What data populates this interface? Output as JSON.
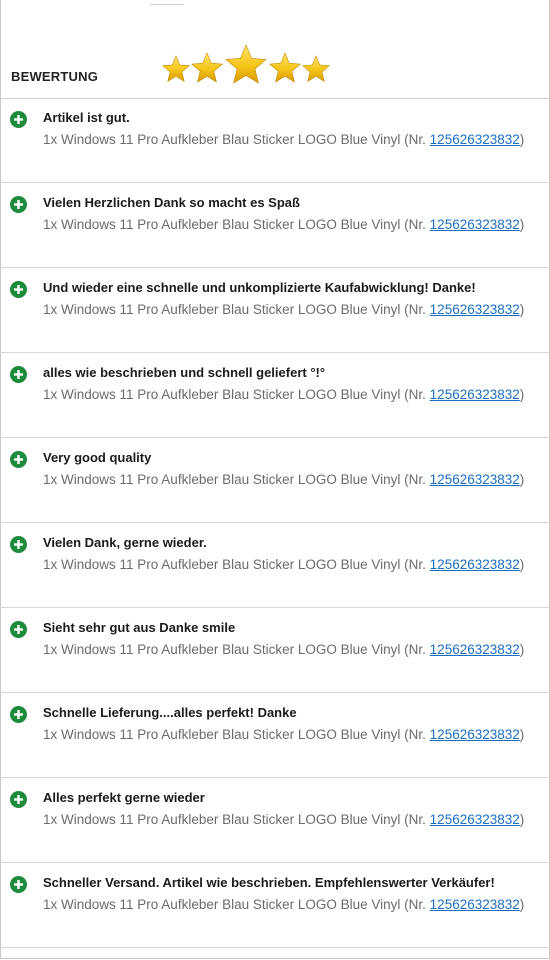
{
  "header": {
    "title": "BEWERTUNG",
    "rating": 5,
    "rating_max": 5,
    "star_color": "#f5c518"
  },
  "colors": {
    "positive_icon": "#1e8a3c",
    "link": "#1a6fc2"
  },
  "feedback": [
    {
      "comment": "Artikel ist gut.",
      "item_prefix": "1x Windows 11 Pro Aufkleber Blau Sticker LOGO Blue Vinyl (Nr. ",
      "item_number": "125626323832",
      "item_suffix": ")",
      "icon": "plus-circle-icon"
    },
    {
      "comment": "Vielen Herzlichen Dank so macht es Spaß",
      "item_prefix": "1x Windows 11 Pro Aufkleber Blau Sticker LOGO Blue Vinyl (Nr. ",
      "item_number": "125626323832",
      "item_suffix": ")",
      "icon": "plus-circle-icon"
    },
    {
      "comment": "Und wieder eine schnelle und unkomplizierte Kaufabwicklung! Danke!",
      "item_prefix": "1x Windows 11 Pro Aufkleber Blau Sticker LOGO Blue Vinyl (Nr. ",
      "item_number": "125626323832",
      "item_suffix": ")",
      "icon": "plus-circle-icon"
    },
    {
      "comment": "alles wie beschrieben und schnell geliefert °!°",
      "item_prefix": "1x Windows 11 Pro Aufkleber Blau Sticker LOGO Blue Vinyl (Nr. ",
      "item_number": "125626323832",
      "item_suffix": ")",
      "icon": "plus-circle-icon"
    },
    {
      "comment": "Very good quality",
      "item_prefix": "1x Windows 11 Pro Aufkleber Blau Sticker LOGO Blue Vinyl (Nr. ",
      "item_number": "125626323832",
      "item_suffix": ")",
      "icon": "plus-circle-icon"
    },
    {
      "comment": "Vielen Dank, gerne wieder.",
      "item_prefix": "1x Windows 11 Pro Aufkleber Blau Sticker LOGO Blue Vinyl (Nr. ",
      "item_number": "125626323832",
      "item_suffix": ")",
      "icon": "plus-circle-icon"
    },
    {
      "comment": "Sieht sehr gut aus Danke smile",
      "item_prefix": "1x Windows 11 Pro Aufkleber Blau Sticker LOGO Blue Vinyl (Nr. ",
      "item_number": "125626323832",
      "item_suffix": ")",
      "icon": "plus-circle-icon"
    },
    {
      "comment": "Schnelle Lieferung....alles perfekt! Danke",
      "item_prefix": "1x Windows 11 Pro Aufkleber Blau Sticker LOGO Blue Vinyl (Nr. ",
      "item_number": "125626323832",
      "item_suffix": ")",
      "icon": "plus-circle-icon"
    },
    {
      "comment": "Alles perfekt gerne wieder",
      "item_prefix": "1x Windows 11 Pro Aufkleber Blau Sticker LOGO Blue Vinyl (Nr. ",
      "item_number": "125626323832",
      "item_suffix": ")",
      "icon": "plus-circle-icon"
    },
    {
      "comment": "Schneller Versand. Artikel wie beschrieben. Empfehlenswerter Verkäufer!",
      "item_prefix": "1x Windows 11 Pro Aufkleber Blau Sticker LOGO Blue Vinyl (Nr. ",
      "item_number": "125626323832",
      "item_suffix": ")",
      "icon": "plus-circle-icon"
    }
  ]
}
